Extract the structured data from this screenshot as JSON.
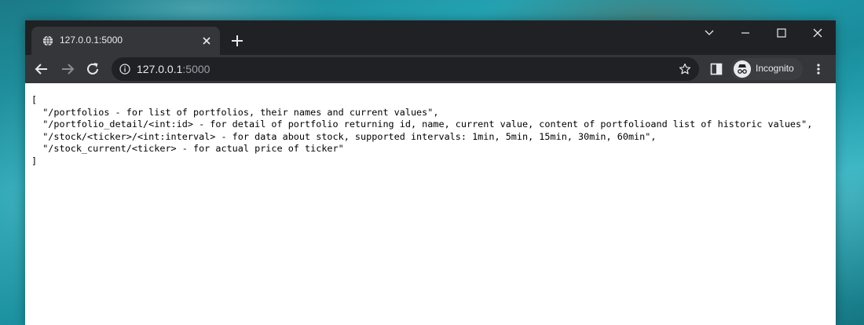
{
  "browser": {
    "tab": {
      "title": "127.0.0.1:5000",
      "favicon": "globe-icon",
      "close_icon": "close-icon"
    },
    "new_tab_icon": "plus-icon",
    "window_controls": [
      "chevron-down-icon",
      "minimize-icon",
      "maximize-icon",
      "close-icon"
    ],
    "address_bar": {
      "host": "127.0.0.1",
      "port": ":5000",
      "info_icon": "info-icon",
      "bookmark_icon": "star-icon"
    },
    "profile": {
      "label": "Incognito",
      "icon": "incognito-icon"
    },
    "colors": {
      "titlebar": "#202124",
      "toolbar": "#35363a",
      "omnibox": "#202124",
      "text": "#e8eaed",
      "text_muted": "#9aa0a6"
    }
  },
  "page": {
    "lines": [
      "[",
      "  \"/portfolios - for list of portfolios, their names and current values\",",
      "  \"/portfolio_detail/<int:id> - for detail of portfolio returning id, name, current value, content of portfolioand list of historic values\",",
      "  \"/stock/<ticker>/<int:interval> - for data about stock, supported intervals: 1min, 5min, 15min, 30min, 60min\",",
      "  \"/stock_current/<ticker> - for actual price of ticker\"",
      "]"
    ]
  }
}
